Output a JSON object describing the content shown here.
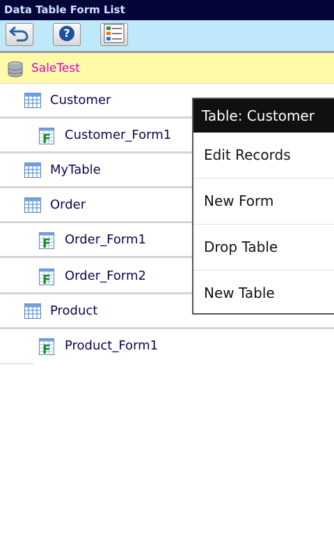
{
  "title": "Data Table Form List",
  "toolbar": {
    "buttons": [
      {
        "name": "back-button",
        "icon": "back-arrow-icon"
      },
      {
        "name": "help-button",
        "icon": "help-icon"
      },
      {
        "name": "list-view-button",
        "icon": "list-icon"
      }
    ]
  },
  "database": {
    "label": "SaleTest",
    "icon": "database-icon"
  },
  "rows": [
    {
      "label": "Customer",
      "type": "table"
    },
    {
      "label": "Customer_Form1",
      "type": "form"
    },
    {
      "label": "MyTable",
      "type": "table"
    },
    {
      "label": "Order",
      "type": "table"
    },
    {
      "label": "Order_Form1",
      "type": "form"
    },
    {
      "label": "Order_Form2",
      "type": "form"
    },
    {
      "label": "Product",
      "type": "table"
    },
    {
      "label": "Product_Form1",
      "type": "form"
    }
  ],
  "context_menu": {
    "title": "Table: Customer",
    "items": [
      "Edit Records",
      "New Form",
      "Drop Table",
      "New Table"
    ]
  },
  "colors": {
    "title_bar": "#05053a",
    "toolbar": "#bfe9fb",
    "database_row": "#fffaa8",
    "database_label": "#e000d0",
    "row_text": "#07074f"
  }
}
